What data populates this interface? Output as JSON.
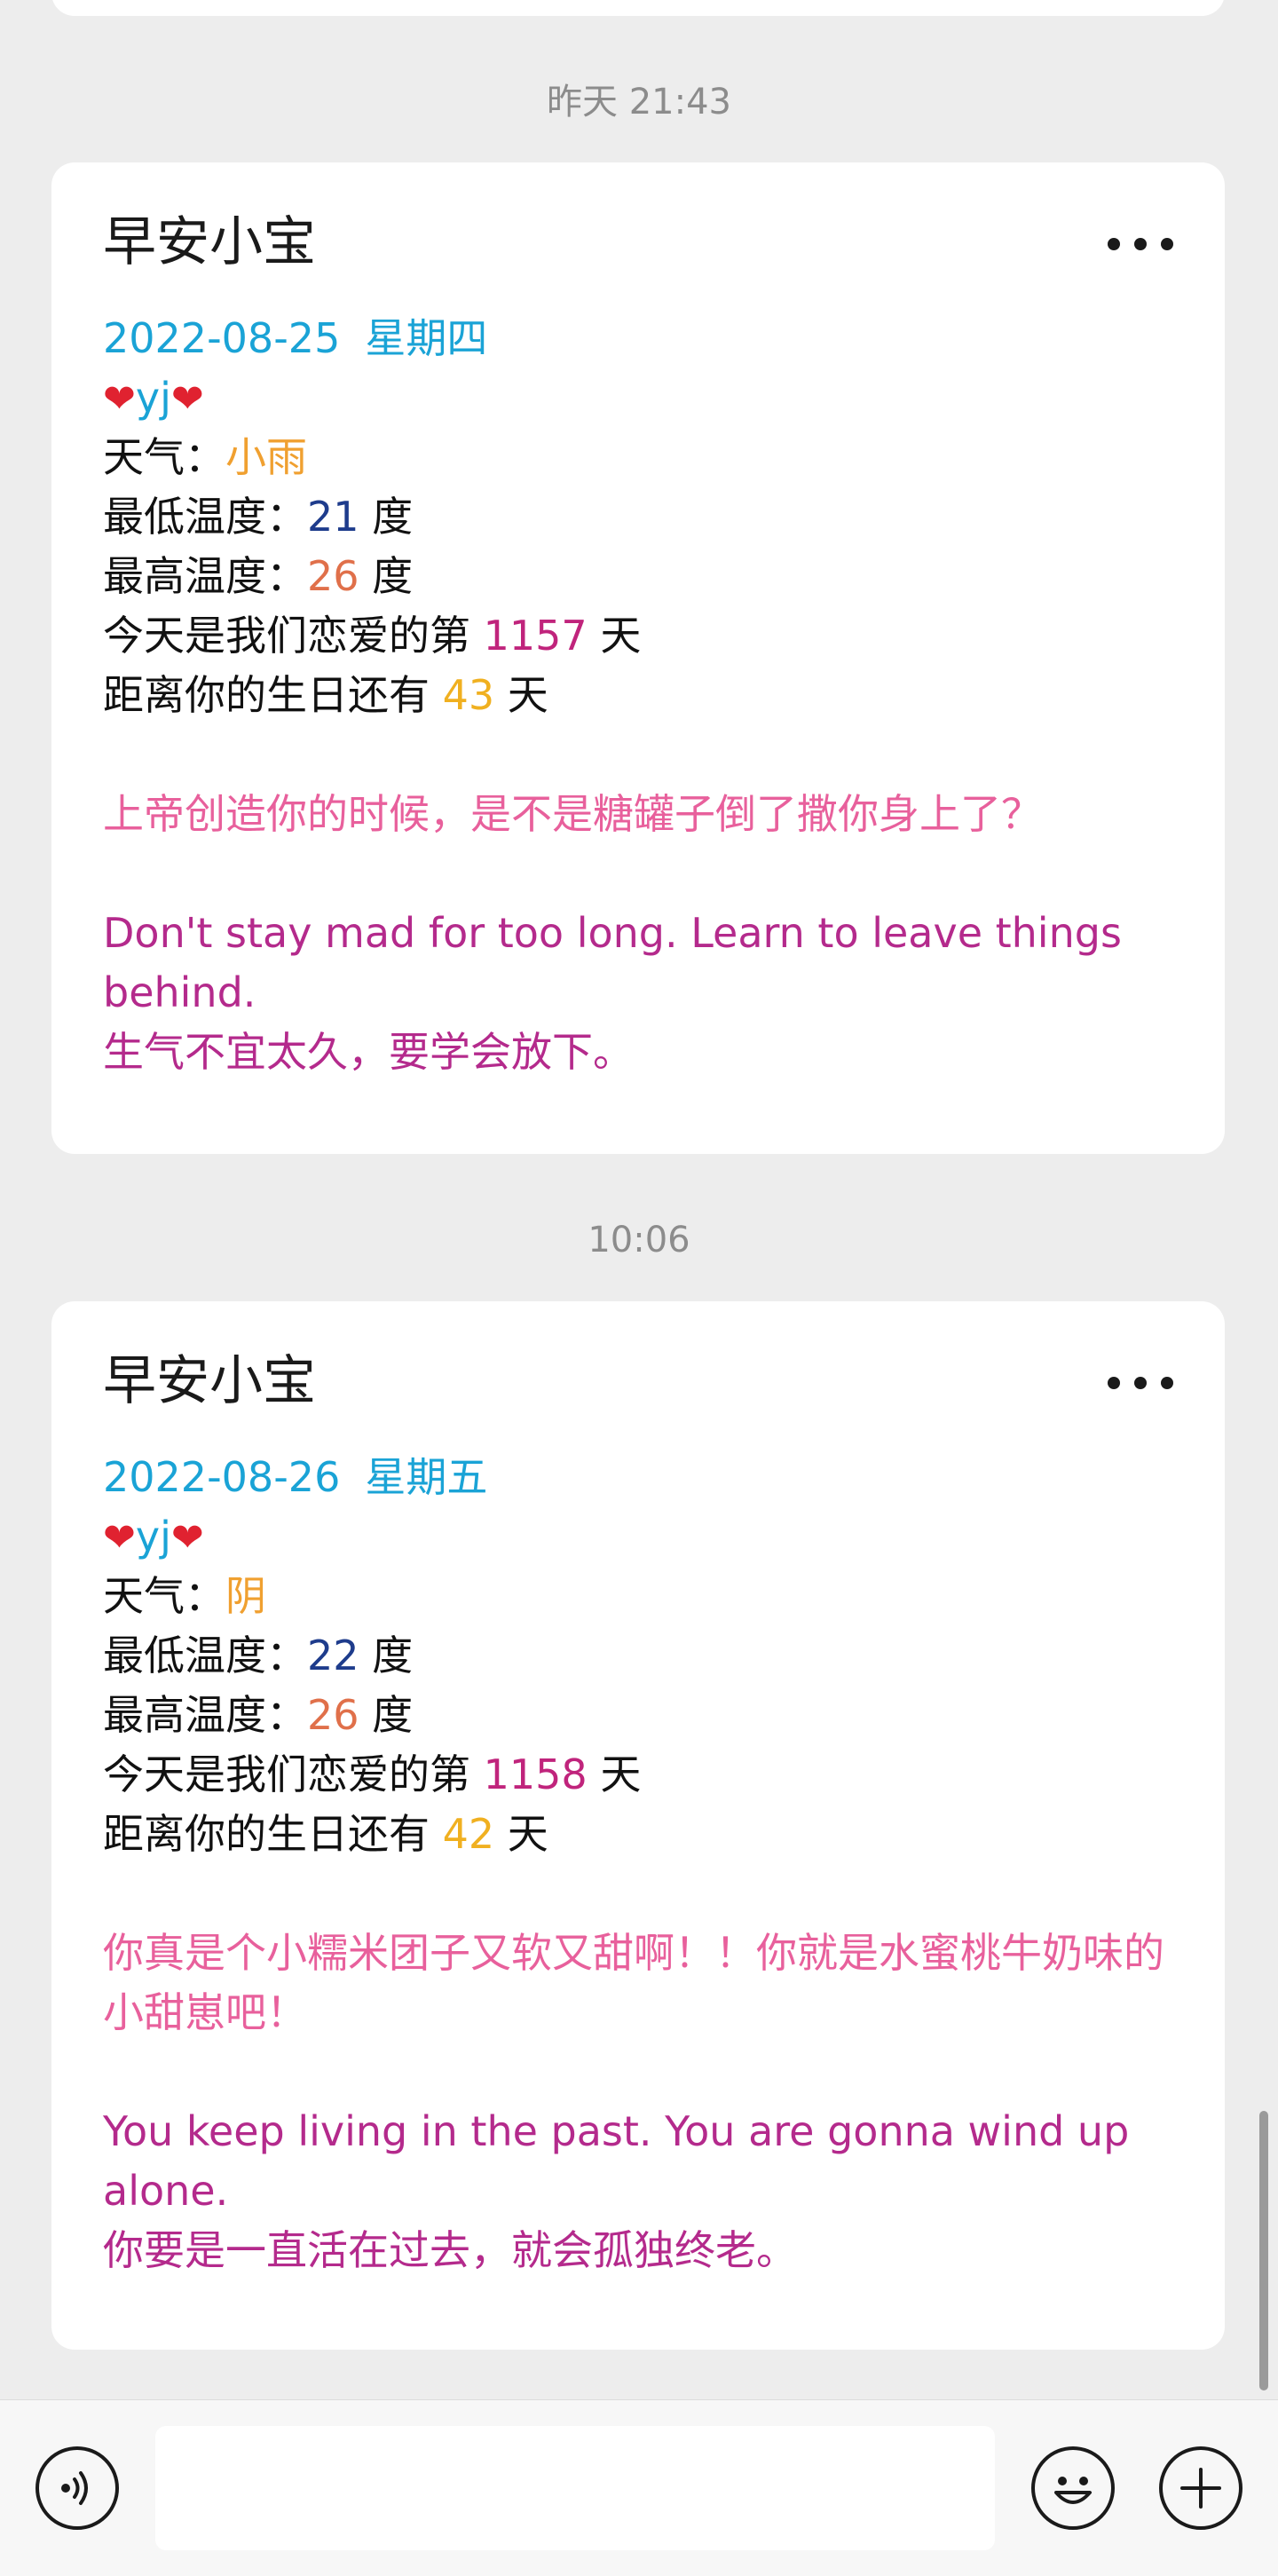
{
  "timestamps": [
    "昨天 21:43",
    "10:06"
  ],
  "cards": [
    {
      "title": "早安小宝",
      "date": "2022-08-25",
      "weekday": "星期四",
      "heart": "❤",
      "name": "yj",
      "weather_label": "天气：",
      "weather": "小雨",
      "low_label": "最低温度：",
      "low": "21",
      "unit_du": " 度",
      "high_label": "最高温度：",
      "high": "26",
      "love_label": "今天是我们恋爱的第 ",
      "love_days": "1157",
      "unit_tian": " 天",
      "bday_label": "距离你的生日还有 ",
      "bday_days": "43",
      "quote_cn": "上帝创造你的时候，是不是糖罐子倒了撒你身上了？",
      "quote_en": "Don't stay mad for too long. Learn to leave things behind.",
      "quote_en_cn": "生气不宜太久，要学会放下。"
    },
    {
      "title": "早安小宝",
      "date": "2022-08-26",
      "weekday": "星期五",
      "heart": "❤",
      "name": "yj",
      "weather_label": "天气：",
      "weather": "阴",
      "low_label": "最低温度：",
      "low": "22",
      "unit_du": " 度",
      "high_label": "最高温度：",
      "high": "26",
      "love_label": "今天是我们恋爱的第 ",
      "love_days": "1158",
      "unit_tian": " 天",
      "bday_label": "距离你的生日还有 ",
      "bday_days": "42",
      "quote_cn": "你真是个小糯米团子又软又甜啊！！你就是水蜜桃牛奶味的小甜崽吧！",
      "quote_en": "You keep living in the past. You are gonna wind up alone.",
      "quote_en_cn": "你要是一直活在过去，就会孤独终老。"
    }
  ],
  "input": {
    "value": "",
    "placeholder": ""
  },
  "icons": {
    "voice": "voice-icon",
    "emoji": "emoji-icon",
    "plus": "plus-icon",
    "more": "more-icon"
  }
}
